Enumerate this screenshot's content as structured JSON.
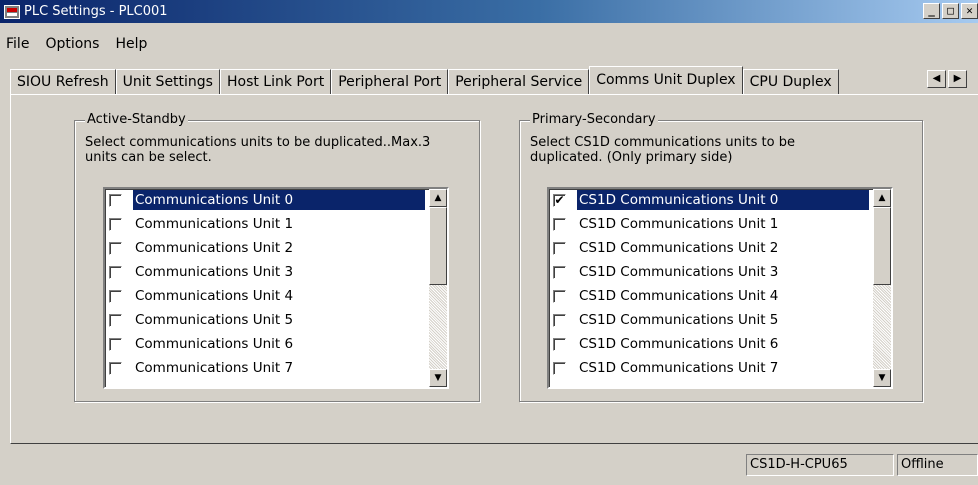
{
  "window": {
    "title": "PLC Settings - PLC001"
  },
  "menu": {
    "items": [
      "File",
      "Options",
      "Help"
    ]
  },
  "tabs": [
    "SIOU Refresh",
    "Unit Settings",
    "Host Link Port",
    "Peripheral Port",
    "Peripheral Service",
    "Comms Unit Duplex",
    "CPU Duplex"
  ],
  "active_tab": "Comms Unit Duplex",
  "active_standby": {
    "legend": "Active-Standby",
    "desc_line1": "Select communications units to be duplicated..Max.3",
    "desc_line2": "units can be select.",
    "items": [
      {
        "label": "Communications Unit 0",
        "checked": false,
        "selected": true
      },
      {
        "label": "Communications Unit 1",
        "checked": false
      },
      {
        "label": "Communications Unit 2",
        "checked": false
      },
      {
        "label": "Communications Unit 3",
        "checked": false
      },
      {
        "label": "Communications Unit 4",
        "checked": false
      },
      {
        "label": "Communications Unit 5",
        "checked": false
      },
      {
        "label": "Communications Unit 6",
        "checked": false
      },
      {
        "label": "Communications Unit 7",
        "checked": false
      }
    ]
  },
  "primary_secondary": {
    "legend": "Primary-Secondary",
    "desc_line1": "Select CS1D communications units to be",
    "desc_line2": "duplicated. (Only primary side)",
    "items": [
      {
        "label": "CS1D Communications Unit 0",
        "checked": true,
        "selected": true
      },
      {
        "label": "CS1D Communications Unit 1",
        "checked": false
      },
      {
        "label": "CS1D Communications Unit 2",
        "checked": false
      },
      {
        "label": "CS1D Communications Unit 3",
        "checked": false
      },
      {
        "label": "CS1D Communications Unit 4",
        "checked": false
      },
      {
        "label": "CS1D Communications Unit 5",
        "checked": false
      },
      {
        "label": "CS1D Communications Unit 6",
        "checked": false
      },
      {
        "label": "CS1D Communications Unit 7",
        "checked": false
      }
    ]
  },
  "status": {
    "cpu_model": "CS1D-H-CPU65",
    "connection": "Offline"
  },
  "icons": {
    "app": "plc-app-icon",
    "minimize": "minimize-icon",
    "maximize": "maximize-icon",
    "close": "close-icon",
    "tab_left": "arrow-left-icon",
    "tab_right": "arrow-right-icon",
    "scroll_up": "arrow-up-icon",
    "scroll_down": "arrow-down-icon",
    "check": "checkmark-icon"
  }
}
